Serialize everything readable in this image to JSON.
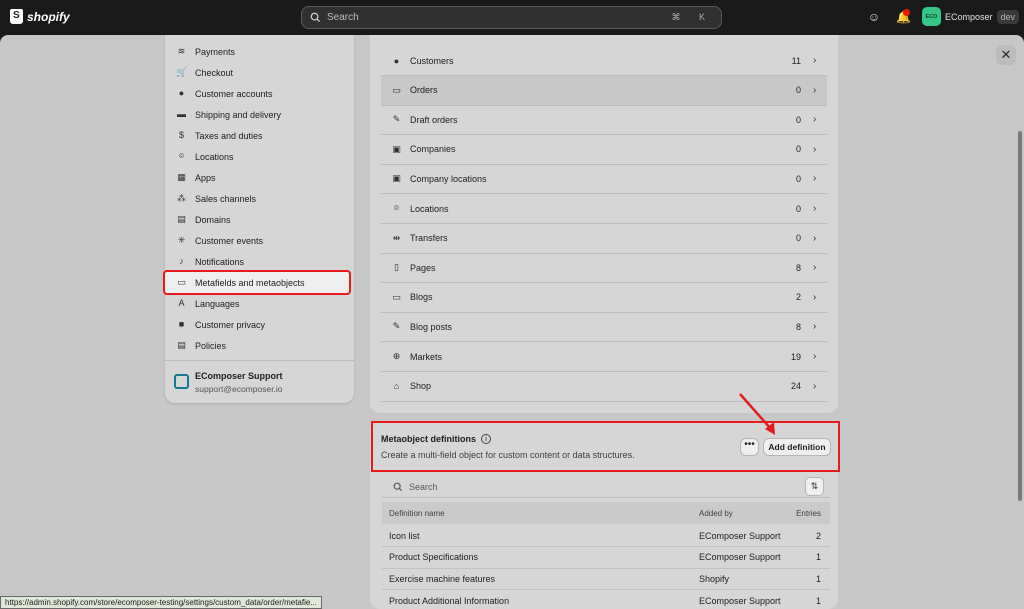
{
  "topbar": {
    "brand": "shopify",
    "search_placeholder": "Search",
    "shortcut": "⌘ K",
    "notification_count": "1",
    "store_initials": "ECO",
    "store_name": "EComposer",
    "store_badge": "dev"
  },
  "sidebar": {
    "items": [
      {
        "label": "Payments",
        "icon": "payments-icon"
      },
      {
        "label": "Checkout",
        "icon": "cart-icon"
      },
      {
        "label": "Customer accounts",
        "icon": "person-icon"
      },
      {
        "label": "Shipping and delivery",
        "icon": "truck-icon"
      },
      {
        "label": "Taxes and duties",
        "icon": "tax-icon"
      },
      {
        "label": "Locations",
        "icon": "location-icon"
      },
      {
        "label": "Apps",
        "icon": "apps-icon"
      },
      {
        "label": "Sales channels",
        "icon": "channels-icon"
      },
      {
        "label": "Domains",
        "icon": "domain-icon"
      },
      {
        "label": "Customer events",
        "icon": "events-icon"
      },
      {
        "label": "Notifications",
        "icon": "bell-icon"
      },
      {
        "label": "Metafields and metaobjects",
        "icon": "metafields-icon"
      },
      {
        "label": "Languages",
        "icon": "languages-icon"
      },
      {
        "label": "Customer privacy",
        "icon": "lock-icon"
      },
      {
        "label": "Policies",
        "icon": "policies-icon"
      }
    ],
    "active_index": 11,
    "support": {
      "name": "EComposer Support",
      "email": "support@ecomposer.io"
    }
  },
  "resources": [
    {
      "label": "Customers",
      "count": "11",
      "icon": "person-icon"
    },
    {
      "label": "Orders",
      "count": "0",
      "icon": "inbox-icon"
    },
    {
      "label": "Draft orders",
      "count": "0",
      "icon": "draft-icon"
    },
    {
      "label": "Companies",
      "count": "0",
      "icon": "company-icon"
    },
    {
      "label": "Company locations",
      "count": "0",
      "icon": "company-location-icon"
    },
    {
      "label": "Locations",
      "count": "0",
      "icon": "location-icon"
    },
    {
      "label": "Transfers",
      "count": "0",
      "icon": "transfer-icon"
    },
    {
      "label": "Pages",
      "count": "8",
      "icon": "page-icon"
    },
    {
      "label": "Blogs",
      "count": "2",
      "icon": "blog-icon"
    },
    {
      "label": "Blog posts",
      "count": "8",
      "icon": "pen-icon"
    },
    {
      "label": "Markets",
      "count": "19",
      "icon": "globe-icon"
    },
    {
      "label": "Shop",
      "count": "24",
      "icon": "shop-icon"
    }
  ],
  "metaobjects": {
    "title": "Metaobject definitions",
    "subtitle": "Create a multi-field object for custom content or data structures.",
    "more_label": "•••",
    "add_label": "Add definition",
    "search_placeholder": "Search",
    "columns": [
      "Definition name",
      "Added by",
      "Entries"
    ],
    "rows": [
      [
        "Icon list",
        "EComposer Support",
        "2"
      ],
      [
        "Product Specifications",
        "EComposer Support",
        "1"
      ],
      [
        "Exercise machine features",
        "Shopify",
        "1"
      ],
      [
        "Product Additional Information",
        "EComposer Support",
        "1"
      ]
    ]
  },
  "status_url": "https://admin.shopify.com/store/ecomposer-testing/settings/custom_data/order/metafie...",
  "colors": {
    "highlight": "#e51c1c",
    "store_avatar": "#36c685"
  }
}
